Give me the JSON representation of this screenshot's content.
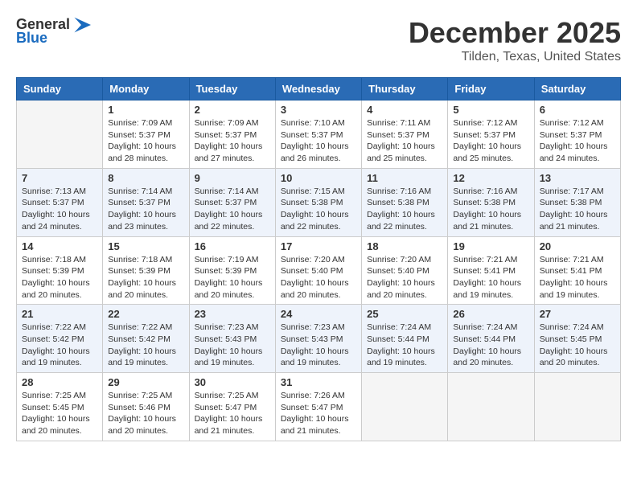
{
  "logo": {
    "general": "General",
    "blue": "Blue"
  },
  "title": "December 2025",
  "location": "Tilden, Texas, United States",
  "days_of_week": [
    "Sunday",
    "Monday",
    "Tuesday",
    "Wednesday",
    "Thursday",
    "Friday",
    "Saturday"
  ],
  "weeks": [
    [
      {
        "day": "",
        "info": ""
      },
      {
        "day": "1",
        "info": "Sunrise: 7:09 AM\nSunset: 5:37 PM\nDaylight: 10 hours\nand 28 minutes."
      },
      {
        "day": "2",
        "info": "Sunrise: 7:09 AM\nSunset: 5:37 PM\nDaylight: 10 hours\nand 27 minutes."
      },
      {
        "day": "3",
        "info": "Sunrise: 7:10 AM\nSunset: 5:37 PM\nDaylight: 10 hours\nand 26 minutes."
      },
      {
        "day": "4",
        "info": "Sunrise: 7:11 AM\nSunset: 5:37 PM\nDaylight: 10 hours\nand 25 minutes."
      },
      {
        "day": "5",
        "info": "Sunrise: 7:12 AM\nSunset: 5:37 PM\nDaylight: 10 hours\nand 25 minutes."
      },
      {
        "day": "6",
        "info": "Sunrise: 7:12 AM\nSunset: 5:37 PM\nDaylight: 10 hours\nand 24 minutes."
      }
    ],
    [
      {
        "day": "7",
        "info": "Sunrise: 7:13 AM\nSunset: 5:37 PM\nDaylight: 10 hours\nand 24 minutes."
      },
      {
        "day": "8",
        "info": "Sunrise: 7:14 AM\nSunset: 5:37 PM\nDaylight: 10 hours\nand 23 minutes."
      },
      {
        "day": "9",
        "info": "Sunrise: 7:14 AM\nSunset: 5:37 PM\nDaylight: 10 hours\nand 22 minutes."
      },
      {
        "day": "10",
        "info": "Sunrise: 7:15 AM\nSunset: 5:38 PM\nDaylight: 10 hours\nand 22 minutes."
      },
      {
        "day": "11",
        "info": "Sunrise: 7:16 AM\nSunset: 5:38 PM\nDaylight: 10 hours\nand 22 minutes."
      },
      {
        "day": "12",
        "info": "Sunrise: 7:16 AM\nSunset: 5:38 PM\nDaylight: 10 hours\nand 21 minutes."
      },
      {
        "day": "13",
        "info": "Sunrise: 7:17 AM\nSunset: 5:38 PM\nDaylight: 10 hours\nand 21 minutes."
      }
    ],
    [
      {
        "day": "14",
        "info": "Sunrise: 7:18 AM\nSunset: 5:39 PM\nDaylight: 10 hours\nand 20 minutes."
      },
      {
        "day": "15",
        "info": "Sunrise: 7:18 AM\nSunset: 5:39 PM\nDaylight: 10 hours\nand 20 minutes."
      },
      {
        "day": "16",
        "info": "Sunrise: 7:19 AM\nSunset: 5:39 PM\nDaylight: 10 hours\nand 20 minutes."
      },
      {
        "day": "17",
        "info": "Sunrise: 7:20 AM\nSunset: 5:40 PM\nDaylight: 10 hours\nand 20 minutes."
      },
      {
        "day": "18",
        "info": "Sunrise: 7:20 AM\nSunset: 5:40 PM\nDaylight: 10 hours\nand 20 minutes."
      },
      {
        "day": "19",
        "info": "Sunrise: 7:21 AM\nSunset: 5:41 PM\nDaylight: 10 hours\nand 19 minutes."
      },
      {
        "day": "20",
        "info": "Sunrise: 7:21 AM\nSunset: 5:41 PM\nDaylight: 10 hours\nand 19 minutes."
      }
    ],
    [
      {
        "day": "21",
        "info": "Sunrise: 7:22 AM\nSunset: 5:42 PM\nDaylight: 10 hours\nand 19 minutes."
      },
      {
        "day": "22",
        "info": "Sunrise: 7:22 AM\nSunset: 5:42 PM\nDaylight: 10 hours\nand 19 minutes."
      },
      {
        "day": "23",
        "info": "Sunrise: 7:23 AM\nSunset: 5:43 PM\nDaylight: 10 hours\nand 19 minutes."
      },
      {
        "day": "24",
        "info": "Sunrise: 7:23 AM\nSunset: 5:43 PM\nDaylight: 10 hours\nand 19 minutes."
      },
      {
        "day": "25",
        "info": "Sunrise: 7:24 AM\nSunset: 5:44 PM\nDaylight: 10 hours\nand 19 minutes."
      },
      {
        "day": "26",
        "info": "Sunrise: 7:24 AM\nSunset: 5:44 PM\nDaylight: 10 hours\nand 20 minutes."
      },
      {
        "day": "27",
        "info": "Sunrise: 7:24 AM\nSunset: 5:45 PM\nDaylight: 10 hours\nand 20 minutes."
      }
    ],
    [
      {
        "day": "28",
        "info": "Sunrise: 7:25 AM\nSunset: 5:45 PM\nDaylight: 10 hours\nand 20 minutes."
      },
      {
        "day": "29",
        "info": "Sunrise: 7:25 AM\nSunset: 5:46 PM\nDaylight: 10 hours\nand 20 minutes."
      },
      {
        "day": "30",
        "info": "Sunrise: 7:25 AM\nSunset: 5:47 PM\nDaylight: 10 hours\nand 21 minutes."
      },
      {
        "day": "31",
        "info": "Sunrise: 7:26 AM\nSunset: 5:47 PM\nDaylight: 10 hours\nand 21 minutes."
      },
      {
        "day": "",
        "info": ""
      },
      {
        "day": "",
        "info": ""
      },
      {
        "day": "",
        "info": ""
      }
    ]
  ]
}
